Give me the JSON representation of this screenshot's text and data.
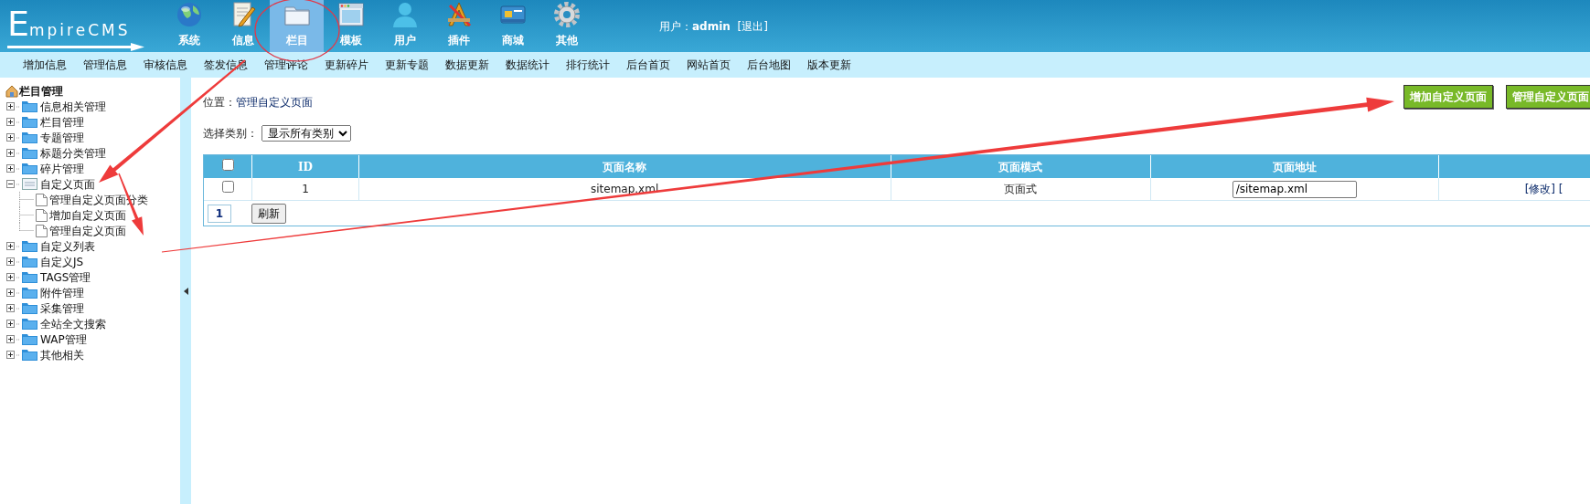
{
  "logo": "EmpireCMS",
  "nav": [
    {
      "label": "系统",
      "selected": false
    },
    {
      "label": "信息",
      "selected": false
    },
    {
      "label": "栏目",
      "selected": true
    },
    {
      "label": "模板",
      "selected": false
    },
    {
      "label": "用户",
      "selected": false
    },
    {
      "label": "插件",
      "selected": false
    },
    {
      "label": "商城",
      "selected": false
    },
    {
      "label": "其他",
      "selected": false
    }
  ],
  "user": {
    "label": "用户：",
    "name": "admin",
    "logout": "[退出]"
  },
  "menu": [
    "增加信息",
    "管理信息",
    "审核信息",
    "签发信息",
    "管理评论",
    "更新碎片",
    "更新专题",
    "数据更新",
    "数据统计",
    "排行统计",
    "后台首页",
    "网站首页",
    "后台地图",
    "版本更新"
  ],
  "sidebar": {
    "title": "栏目管理",
    "items": [
      {
        "label": "信息相关管理",
        "expanded": false
      },
      {
        "label": "栏目管理",
        "expanded": false
      },
      {
        "label": "专题管理",
        "expanded": false
      },
      {
        "label": "标题分类管理",
        "expanded": false
      },
      {
        "label": "碎片管理",
        "expanded": false
      },
      {
        "label": "自定义页面",
        "expanded": true,
        "children": [
          {
            "label": "管理自定义页面分类"
          },
          {
            "label": "增加自定义页面"
          },
          {
            "label": "管理自定义页面"
          }
        ]
      },
      {
        "label": "自定义列表",
        "expanded": false
      },
      {
        "label": "自定义JS",
        "expanded": false
      },
      {
        "label": "TAGS管理",
        "expanded": false
      },
      {
        "label": "附件管理",
        "expanded": false
      },
      {
        "label": "采集管理",
        "expanded": false
      },
      {
        "label": "全站全文搜索",
        "expanded": false
      },
      {
        "label": "WAP管理",
        "expanded": false
      },
      {
        "label": "其他相关",
        "expanded": false
      }
    ]
  },
  "content": {
    "breadcrumb_label": "位置：",
    "breadcrumb": "管理自定义页面",
    "buttons": [
      "增加自定义页面",
      "管理自定义页面"
    ],
    "filter": {
      "label": "选择类别：",
      "value": "显示所有类别"
    },
    "table": {
      "select_all_checked": false,
      "columns": [
        "ID",
        "页面名称",
        "页面模式",
        "页面地址"
      ],
      "rows": [
        {
          "selected": false,
          "id": "1",
          "name": "sitemap.xml",
          "mode": "页面式",
          "address": "/sitemap.xml",
          "actions": "[修改] ["
        }
      ],
      "page": "1",
      "refresh": "刷新"
    }
  }
}
